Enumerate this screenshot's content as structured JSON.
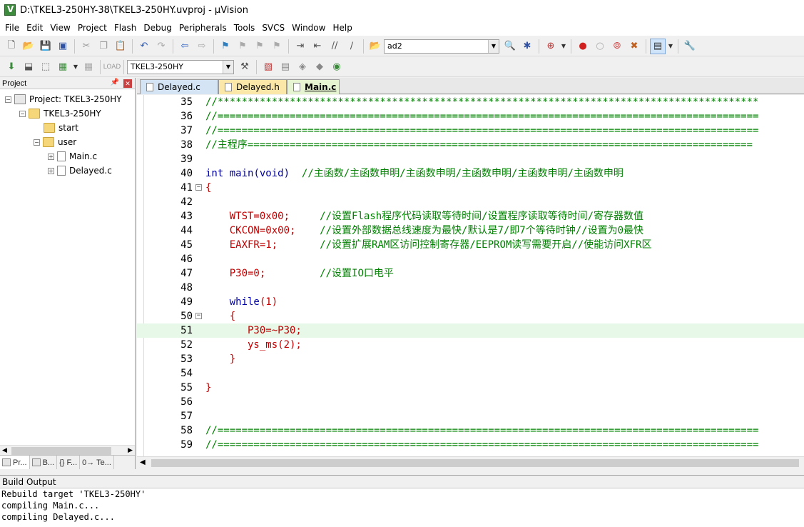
{
  "window": {
    "title": "D:\\TKEL3-250HY-38\\TKEL3-250HY.uvproj - µVision"
  },
  "menu": [
    "File",
    "Edit",
    "View",
    "Project",
    "Flash",
    "Debug",
    "Peripherals",
    "Tools",
    "SVCS",
    "Window",
    "Help"
  ],
  "toolbar": {
    "search_combo": "ad2",
    "target_combo": "TKEL3-250HY"
  },
  "project_panel": {
    "title": "Project",
    "pin_icon": "pin-icon",
    "tree": {
      "root": "Project: TKEL3-250HY",
      "target": "TKEL3-250HY",
      "groups": [
        "start",
        "user"
      ],
      "files": [
        "Main.c",
        "Delayed.c"
      ]
    },
    "tabs": [
      "Pr...",
      "B...",
      "{} F...",
      "0→ Te..."
    ]
  },
  "editor": {
    "tabs": [
      "Delayed.c",
      "Delayed.h",
      "Main.c"
    ],
    "active_tab": "Main.c",
    "lines": [
      {
        "n": "35",
        "text": "//******************************************************************************************"
      },
      {
        "n": "36",
        "text": "//=========================================================================================="
      },
      {
        "n": "37",
        "text": "//=========================================================================================="
      },
      {
        "n": "38",
        "text": "//主程序===================================================================================="
      },
      {
        "n": "39",
        "text": ""
      },
      {
        "n": "40",
        "kw": "int ",
        "fn": "main",
        "p1": "(",
        "kw2": "void",
        "p2": ")  ",
        "text": "//主函数/主函数申明/主函数申明/主函数申明/主函数申明/主函数申明"
      },
      {
        "n": "41",
        "text": "{"
      },
      {
        "n": "42",
        "text": ""
      },
      {
        "n": "43",
        "code": "    WTST=0x00;     ",
        "text": "//设置Flash程序代码读取等待时间/设置程序读取等待时间/寄存器数值"
      },
      {
        "n": "44",
        "code": "    CKCON=0x00;    ",
        "text": "//设置外部数据总线速度为最快/默认是7/即7个等待时钟//设置为0最快"
      },
      {
        "n": "45",
        "code": "    EAXFR=1;       ",
        "text": "//设置扩展RAM区访问控制寄存器/EEPROM读写需要开启//使能访问XFR区"
      },
      {
        "n": "46",
        "text": ""
      },
      {
        "n": "47",
        "code": "    P30=0;         ",
        "text": "//设置IO口电平"
      },
      {
        "n": "48",
        "text": ""
      },
      {
        "n": "49",
        "kw": "    while",
        "text": "(1)"
      },
      {
        "n": "50",
        "text": "    {"
      },
      {
        "n": "51",
        "text": "       P30=~P30;"
      },
      {
        "n": "52",
        "text": "       ys_ms(2);"
      },
      {
        "n": "53",
        "text": "    }"
      },
      {
        "n": "54",
        "text": ""
      },
      {
        "n": "55",
        "text": "}"
      },
      {
        "n": "56",
        "text": ""
      },
      {
        "n": "57",
        "text": ""
      },
      {
        "n": "58",
        "text": "//=========================================================================================="
      },
      {
        "n": "59",
        "text": "//=========================================================================================="
      }
    ]
  },
  "build_output": {
    "title": "Build Output",
    "lines": [
      "Rebuild target 'TKEL3-250HY'",
      "compiling Main.c...",
      "compiling Delayed.c..."
    ]
  }
}
